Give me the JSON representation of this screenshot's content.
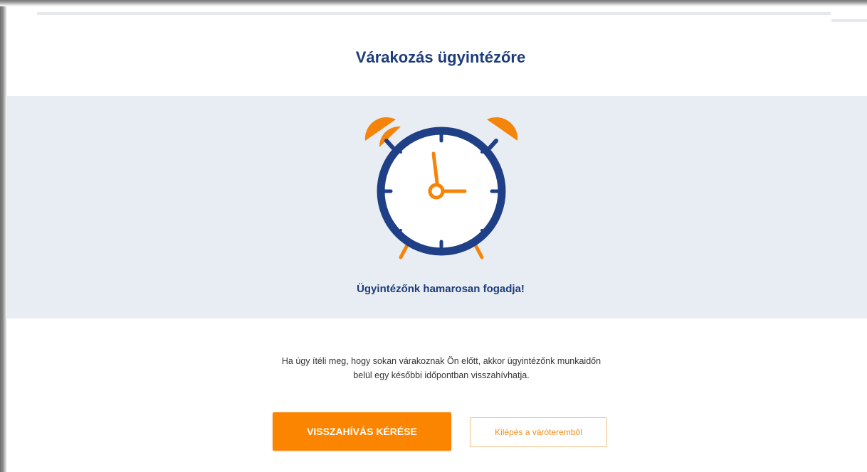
{
  "header": {
    "title": "Várakozás ügyintézőre"
  },
  "waiting": {
    "message": "Ügyintézőnk hamarosan fogadja!",
    "icon": "alarm-clock-icon"
  },
  "info": {
    "line1": "Ha úgy ítéli meg, hogy sokan várakoznak Ön előtt, akkor ügyintézőnk munkaidőn",
    "line2": "belül egy későbbi időpontban visszahívhatja."
  },
  "actions": {
    "callback_label": "VISSZAHÍVÁS KÉRÉSE",
    "exit_label": "Kilépés a váróteremből"
  },
  "colors": {
    "brand_blue": "#1d3c7a",
    "clock_ring": "#1f3f86",
    "accent_orange": "#fb8500",
    "band_bg": "#e8edf3"
  }
}
